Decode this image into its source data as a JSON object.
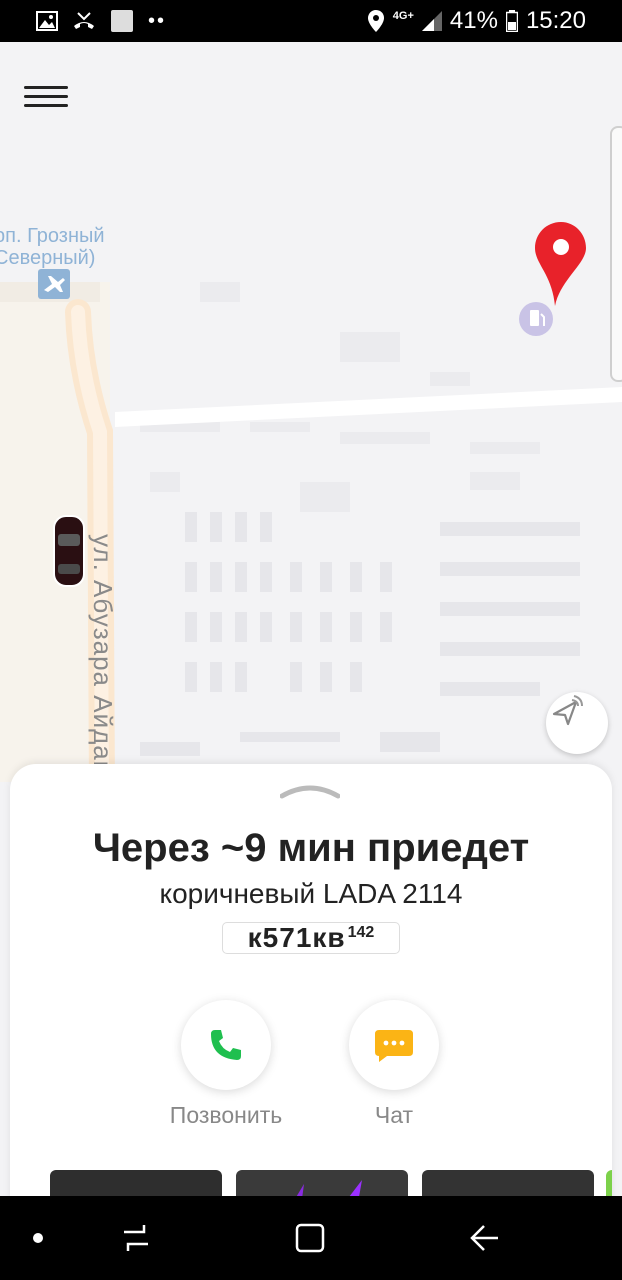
{
  "status_bar": {
    "network": "4G+",
    "battery": "41%",
    "time": "15:20"
  },
  "map": {
    "poi_label_line1": "рп. Грозный",
    "poi_label_line2": "Северный)",
    "street_label": "ул. Абузара Айдамир"
  },
  "sheet": {
    "eta": "Через ~9 мин приедет",
    "car": "коричневый LADA 2114",
    "plate": {
      "main": "к571кв",
      "region": "142"
    },
    "actions": {
      "call_label": "Позвонить",
      "chat_label": "Чат"
    }
  },
  "colors": {
    "pin": "#e8222a",
    "call_icon": "#1fbf4f",
    "chat_icon": "#fbb415"
  }
}
